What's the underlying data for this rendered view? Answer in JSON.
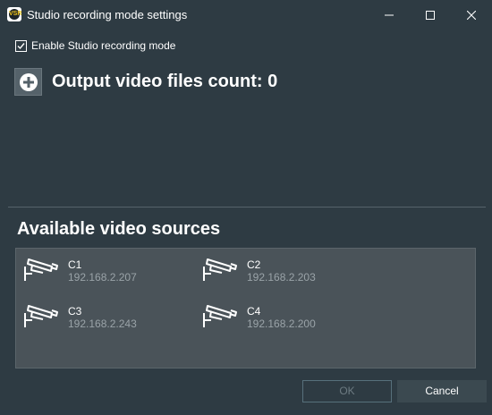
{
  "window": {
    "title": "Studio recording mode settings",
    "app_icon_text": "VSR"
  },
  "settings": {
    "enable_label": "Enable Studio recording mode",
    "enabled": true,
    "output_title": "Output video files count: 0"
  },
  "sources": {
    "title": "Available video sources",
    "items": [
      {
        "name": "C1",
        "ip": "192.168.2.207"
      },
      {
        "name": "C2",
        "ip": "192.168.2.203"
      },
      {
        "name": "C3",
        "ip": "192.168.2.243"
      },
      {
        "name": "C4",
        "ip": "192.168.2.200"
      }
    ],
    "icon": "security-camera-icon"
  },
  "buttons": {
    "ok_label": "OK",
    "cancel_label": "Cancel"
  },
  "colors": {
    "background": "#2e3b43",
    "panel": "#4a5359",
    "muted_text": "#9aa3a8"
  }
}
